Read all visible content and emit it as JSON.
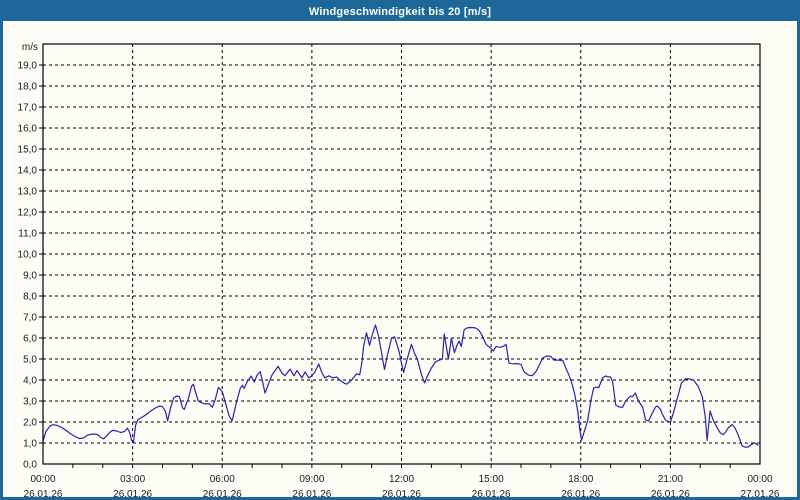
{
  "window": {
    "title": "Windgeschwindigkeit bis 20 [m/s]"
  },
  "colors": {
    "frame": "#1e6899",
    "background": "#fdfdf6",
    "plot_background": "#fdfdf6",
    "line": "#2323bd",
    "grid": "#000000",
    "text": "#1a1a1a"
  },
  "chart_data": {
    "type": "line",
    "title": "Windgeschwindigkeit bis 20 [m/s]",
    "unit_label": "m/s",
    "ylim": [
      0,
      20
    ],
    "xlim_hours": [
      0,
      24
    ],
    "grid": "dashed",
    "legend": "none",
    "y_ticks": [
      {
        "v": 0,
        "label": "0,0"
      },
      {
        "v": 1,
        "label": "1,0"
      },
      {
        "v": 2,
        "label": "2,0"
      },
      {
        "v": 3,
        "label": "3,0"
      },
      {
        "v": 4,
        "label": "4,0"
      },
      {
        "v": 5,
        "label": "5,0"
      },
      {
        "v": 6,
        "label": "6,0"
      },
      {
        "v": 7,
        "label": "7,0"
      },
      {
        "v": 8,
        "label": "8,0"
      },
      {
        "v": 9,
        "label": "9,0"
      },
      {
        "v": 10,
        "label": "10,0"
      },
      {
        "v": 11,
        "label": "11,0"
      },
      {
        "v": 12,
        "label": "12,0"
      },
      {
        "v": 13,
        "label": "13,0"
      },
      {
        "v": 14,
        "label": "14,0"
      },
      {
        "v": 15,
        "label": "15,0"
      },
      {
        "v": 16,
        "label": "16,0"
      },
      {
        "v": 17,
        "label": "17,0"
      },
      {
        "v": 18,
        "label": "18,0"
      },
      {
        "v": 19,
        "label": "19,0"
      }
    ],
    "x_major_ticks": [
      {
        "hour": 0,
        "time": "00:00",
        "date": "26.01.26"
      },
      {
        "hour": 3,
        "time": "03:00",
        "date": "26.01.26"
      },
      {
        "hour": 6,
        "time": "06:00",
        "date": "26.01.26"
      },
      {
        "hour": 9,
        "time": "09:00",
        "date": "26.01.26"
      },
      {
        "hour": 12,
        "time": "12:00",
        "date": "26.01.26"
      },
      {
        "hour": 15,
        "time": "15:00",
        "date": "26.01.26"
      },
      {
        "hour": 18,
        "time": "18:00",
        "date": "26.01.26"
      },
      {
        "hour": 21,
        "time": "21:00",
        "date": "26.01.26"
      },
      {
        "hour": 24,
        "time": "00:00",
        "date": "27.01.26"
      }
    ],
    "x_minor_tick_hours": [
      1,
      2,
      3,
      4,
      5,
      6,
      7,
      8,
      9,
      10,
      11,
      12,
      13,
      14,
      15,
      16,
      17,
      18,
      19,
      20,
      21,
      22,
      23
    ],
    "series": [
      {
        "name": "Windgeschwindigkeit",
        "color": "#2323bd",
        "points": [
          [
            0,
            1.1
          ],
          [
            0.1,
            1.55
          ],
          [
            0.23,
            1.8
          ],
          [
            0.33,
            1.87
          ],
          [
            0.47,
            1.84
          ],
          [
            0.6,
            1.76
          ],
          [
            0.77,
            1.6
          ],
          [
            0.93,
            1.43
          ],
          [
            1.1,
            1.29
          ],
          [
            1.23,
            1.21
          ],
          [
            1.37,
            1.25
          ],
          [
            1.5,
            1.38
          ],
          [
            1.67,
            1.43
          ],
          [
            1.83,
            1.4
          ],
          [
            1.93,
            1.26
          ],
          [
            2.03,
            1.2
          ],
          [
            2.13,
            1.33
          ],
          [
            2.23,
            1.5
          ],
          [
            2.33,
            1.6
          ],
          [
            2.47,
            1.57
          ],
          [
            2.6,
            1.5
          ],
          [
            2.73,
            1.55
          ],
          [
            2.83,
            1.71
          ],
          [
            2.9,
            1.5
          ],
          [
            2.97,
            1.12
          ],
          [
            3.03,
            1.05
          ],
          [
            3.1,
            1.85
          ],
          [
            3.17,
            2.1
          ],
          [
            3.27,
            2.19
          ],
          [
            3.43,
            2.33
          ],
          [
            3.6,
            2.52
          ],
          [
            3.77,
            2.67
          ],
          [
            3.9,
            2.76
          ],
          [
            4,
            2.74
          ],
          [
            4.1,
            2.5
          ],
          [
            4.17,
            2.05
          ],
          [
            4.27,
            2.67
          ],
          [
            4.37,
            3.14
          ],
          [
            4.47,
            3.24
          ],
          [
            4.57,
            3.2
          ],
          [
            4.67,
            2.67
          ],
          [
            4.73,
            2.6
          ],
          [
            4.87,
            3.14
          ],
          [
            4.97,
            3.7
          ],
          [
            5.03,
            3.8
          ],
          [
            5.13,
            3.3
          ],
          [
            5.2,
            3
          ],
          [
            5.33,
            2.9
          ],
          [
            5.43,
            2.86
          ],
          [
            5.57,
            2.86
          ],
          [
            5.67,
            2.7
          ],
          [
            5.77,
            3.1
          ],
          [
            5.87,
            3.65
          ],
          [
            6,
            3.45
          ],
          [
            6.13,
            2.8
          ],
          [
            6.23,
            2.3
          ],
          [
            6.33,
            2.05
          ],
          [
            6.47,
            2.9
          ],
          [
            6.6,
            3.6
          ],
          [
            6.67,
            3.75
          ],
          [
            6.73,
            3.6
          ],
          [
            6.83,
            3.9
          ],
          [
            6.97,
            4.19
          ],
          [
            7.07,
            3.9
          ],
          [
            7.17,
            4.25
          ],
          [
            7.27,
            4.4
          ],
          [
            7.33,
            4.05
          ],
          [
            7.43,
            3.38
          ],
          [
            7.57,
            3.9
          ],
          [
            7.67,
            4.25
          ],
          [
            7.87,
            4.65
          ],
          [
            8,
            4.33
          ],
          [
            8.1,
            4.2
          ],
          [
            8.27,
            4.52
          ],
          [
            8.4,
            4.2
          ],
          [
            8.5,
            4.45
          ],
          [
            8.67,
            4.1
          ],
          [
            8.77,
            4.38
          ],
          [
            8.9,
            4.1
          ],
          [
            9,
            4.2
          ],
          [
            9.1,
            4.38
          ],
          [
            9.23,
            4.76
          ],
          [
            9.33,
            4.38
          ],
          [
            9.43,
            4.1
          ],
          [
            9.57,
            4.2
          ],
          [
            9.7,
            4.1
          ],
          [
            9.83,
            4.15
          ],
          [
            9.93,
            4
          ],
          [
            10.07,
            3.86
          ],
          [
            10.17,
            3.8
          ],
          [
            10.33,
            4
          ],
          [
            10.5,
            4.3
          ],
          [
            10.6,
            4.25
          ],
          [
            10.67,
            4.8
          ],
          [
            10.73,
            5.6
          ],
          [
            10.83,
            6.25
          ],
          [
            10.93,
            5.65
          ],
          [
            11.03,
            6.2
          ],
          [
            11.13,
            6.62
          ],
          [
            11.23,
            6.1
          ],
          [
            11.33,
            5.3
          ],
          [
            11.43,
            4.5
          ],
          [
            11.53,
            5.2
          ],
          [
            11.67,
            6
          ],
          [
            11.77,
            6.05
          ],
          [
            11.87,
            5.6
          ],
          [
            11.93,
            5.3
          ],
          [
            12,
            4.8
          ],
          [
            12.07,
            4.35
          ],
          [
            12.17,
            4.9
          ],
          [
            12.27,
            5.4
          ],
          [
            12.33,
            5.7
          ],
          [
            12.43,
            5.3
          ],
          [
            12.53,
            5
          ],
          [
            12.67,
            4.25
          ],
          [
            12.77,
            3.86
          ],
          [
            12.87,
            4.2
          ],
          [
            13,
            4.57
          ],
          [
            13.13,
            4.86
          ],
          [
            13.27,
            4.95
          ],
          [
            13.37,
            5
          ],
          [
            13.43,
            6.19
          ],
          [
            13.5,
            5.6
          ],
          [
            13.57,
            5
          ],
          [
            13.67,
            6
          ],
          [
            13.77,
            5.3
          ],
          [
            13.87,
            5.7
          ],
          [
            13.93,
            5.85
          ],
          [
            14,
            5.6
          ],
          [
            14.1,
            6.4
          ],
          [
            14.2,
            6.48
          ],
          [
            14.33,
            6.5
          ],
          [
            14.47,
            6.48
          ],
          [
            14.57,
            6.4
          ],
          [
            14.67,
            6.2
          ],
          [
            14.83,
            5.7
          ],
          [
            15,
            5.5
          ],
          [
            15.07,
            5.38
          ],
          [
            15.17,
            5.6
          ],
          [
            15.3,
            5.55
          ],
          [
            15.43,
            5.62
          ],
          [
            15.5,
            5.7
          ],
          [
            15.6,
            4.8
          ],
          [
            15.73,
            4.77
          ],
          [
            15.87,
            4.78
          ],
          [
            16,
            4.75
          ],
          [
            16.1,
            4.4
          ],
          [
            16.23,
            4.25
          ],
          [
            16.37,
            4.2
          ],
          [
            16.5,
            4.4
          ],
          [
            16.6,
            4.67
          ],
          [
            16.73,
            5.05
          ],
          [
            16.87,
            5.15
          ],
          [
            17,
            5.12
          ],
          [
            17.1,
            4.95
          ],
          [
            17.27,
            4.95
          ],
          [
            17.4,
            4.93
          ],
          [
            17.5,
            4.57
          ],
          [
            17.6,
            4.25
          ],
          [
            17.7,
            3.86
          ],
          [
            17.8,
            3.3
          ],
          [
            17.9,
            2.5
          ],
          [
            17.97,
            1.6
          ],
          [
            18.03,
            1.14
          ],
          [
            18.13,
            1.6
          ],
          [
            18.23,
            2.05
          ],
          [
            18.33,
            2.95
          ],
          [
            18.43,
            3.62
          ],
          [
            18.53,
            3.66
          ],
          [
            18.6,
            3.64
          ],
          [
            18.73,
            4.1
          ],
          [
            18.83,
            4.19
          ],
          [
            18.93,
            4.15
          ],
          [
            19,
            4.15
          ],
          [
            19.07,
            3.9
          ],
          [
            19.17,
            2.81
          ],
          [
            19.27,
            2.72
          ],
          [
            19.4,
            2.7
          ],
          [
            19.5,
            3
          ],
          [
            19.6,
            3.15
          ],
          [
            19.67,
            3.24
          ],
          [
            19.73,
            3.2
          ],
          [
            19.83,
            3.38
          ],
          [
            19.93,
            3
          ],
          [
            20.07,
            2.71
          ],
          [
            20.17,
            2.1
          ],
          [
            20.27,
            2.05
          ],
          [
            20.4,
            2.43
          ],
          [
            20.5,
            2.71
          ],
          [
            20.57,
            2.76
          ],
          [
            20.67,
            2.6
          ],
          [
            20.73,
            2.38
          ],
          [
            20.83,
            2.1
          ],
          [
            20.93,
            2.02
          ],
          [
            21,
            2
          ],
          [
            21.1,
            2.43
          ],
          [
            21.23,
            3.1
          ],
          [
            21.37,
            3.85
          ],
          [
            21.5,
            4.05
          ],
          [
            21.63,
            4.05
          ],
          [
            21.77,
            4
          ],
          [
            21.93,
            3.7
          ],
          [
            22.07,
            3.2
          ],
          [
            22.17,
            2.24
          ],
          [
            22.23,
            1.12
          ],
          [
            22.33,
            2.53
          ],
          [
            22.43,
            2.1
          ],
          [
            22.57,
            1.71
          ],
          [
            22.67,
            1.48
          ],
          [
            22.77,
            1.4
          ],
          [
            22.87,
            1.55
          ],
          [
            22.93,
            1.71
          ],
          [
            23.07,
            1.88
          ],
          [
            23.17,
            1.7
          ],
          [
            23.27,
            1.38
          ],
          [
            23.4,
            0.86
          ],
          [
            23.5,
            0.8
          ],
          [
            23.6,
            0.81
          ],
          [
            23.73,
            0.95
          ],
          [
            23.83,
            1
          ],
          [
            23.93,
            0.9
          ]
        ]
      }
    ]
  }
}
